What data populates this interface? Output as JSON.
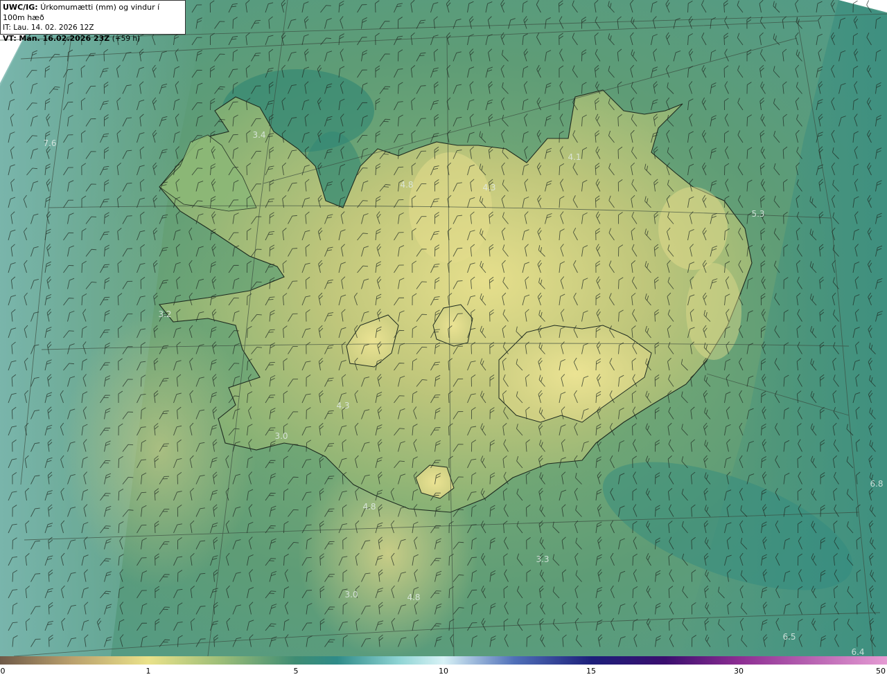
{
  "header": {
    "model": "UWC/IG:",
    "title": "Úrkomumætti (mm) og vindur í 100m hæð",
    "init_prefix": "IT:",
    "init_time": "Lau. 14. 02. 2026 12Z",
    "valid_prefix": "VT:",
    "valid_time": "Mán. 16.02.2026 23Z",
    "lead": "(+59 h)"
  },
  "values": [
    {
      "text": "3.4"
    },
    {
      "text": "7.6"
    },
    {
      "text": "4.8"
    },
    {
      "text": "4.3"
    },
    {
      "text": "4.1"
    },
    {
      "text": "5.3"
    },
    {
      "text": "3.2"
    },
    {
      "text": "4.3"
    },
    {
      "text": "3.0"
    },
    {
      "text": "4.8"
    },
    {
      "text": "3.3"
    },
    {
      "text": "3.0"
    },
    {
      "text": "4.8"
    },
    {
      "text": "6.8"
    },
    {
      "text": "6.5"
    },
    {
      "text": "6.4"
    }
  ],
  "colorbar": {
    "ticks": [
      "0",
      "1",
      "5",
      "10",
      "15",
      "30",
      "50"
    ],
    "colors": [
      "#6f5a48",
      "#b99f6c",
      "#eae28a",
      "#9bbd78",
      "#3e8c73",
      "#2f8b88",
      "#8fd4d4",
      "#d8f2f6",
      "#4f6fb8",
      "#1d1f7a",
      "#3a0e6e",
      "#8c2d92",
      "#e59bd3"
    ]
  }
}
